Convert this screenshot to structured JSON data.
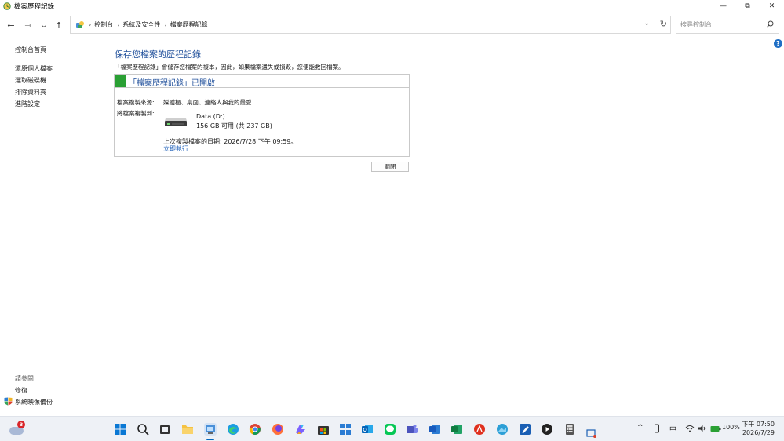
{
  "window": {
    "title": "檔案歷程記錄",
    "controls": {
      "minimize": "—",
      "maximize": "⧉",
      "close": "✕"
    }
  },
  "nav": {
    "back": "←",
    "forward": "→",
    "recent": "⌄",
    "up": "↑",
    "breadcrumbs": [
      "控制台",
      "系統及安全性",
      "檔案歷程記錄"
    ],
    "separator": "›",
    "dropdown": "⌄",
    "refresh": "↻",
    "search_placeholder": "搜尋控制台"
  },
  "help": "?",
  "sidebar": {
    "home": "控制台首頁",
    "items": [
      "還原個人檔案",
      "選取磁碟機",
      "排除資料夾",
      "進階設定"
    ],
    "see_also_title": "請參閱",
    "see_also": [
      "修復",
      "系統映像備份"
    ]
  },
  "main": {
    "title": "保存您檔案的歷程記錄",
    "description": "「檔案歷程記錄」會儲存您檔案的複本，因此，如果檔案遺失或損毀，您便能救回檔案。",
    "status": "「檔案歷程記錄」已開啟",
    "source_label": "檔案複製來源:",
    "source_value": "媒體櫃、桌面、連絡人與我的最愛",
    "target_label": "將檔案複製到:",
    "drive_name": "Data (D:)",
    "drive_space": "156 GB 可用 (共 237 GB)",
    "last_copy": "上次複製檔案的日期: 2026/7/28 下午 09:59。",
    "run_now": "立即執行",
    "close_button": "關閉"
  },
  "taskbar": {
    "weather_badge": "3",
    "tray": {
      "chevron": "^",
      "lang": "中",
      "battery": "100%"
    },
    "time": "下午 07:50",
    "date": "2026/7/29"
  },
  "colors": {
    "accent_blue": "#1e4e9a",
    "link_blue": "#1e5fb8",
    "status_green": "#2aa034"
  }
}
